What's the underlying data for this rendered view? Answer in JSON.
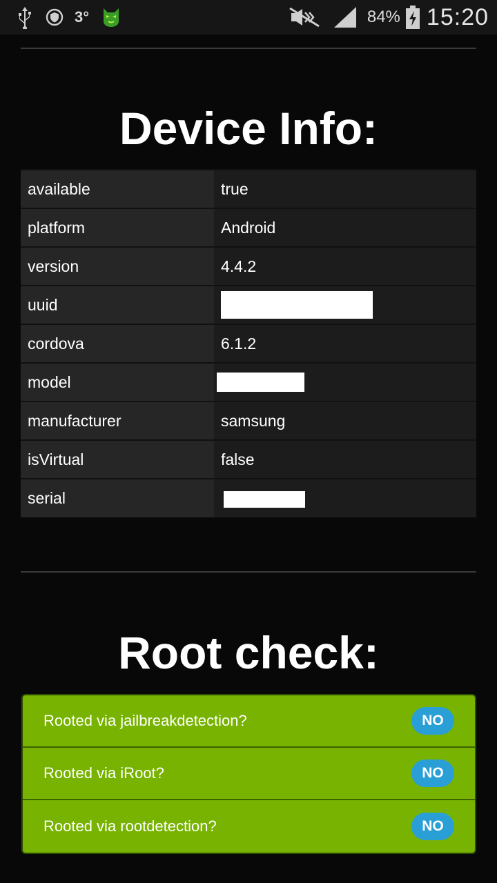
{
  "status_bar": {
    "icons_left": [
      "usb-icon",
      "shield-icon",
      "cat-app-icon"
    ],
    "temperature": "3°",
    "icons_right": [
      "mute-icon",
      "signal-icon",
      "battery-charging-icon"
    ],
    "battery_percent": "84%",
    "time": "15:20"
  },
  "device_info": {
    "title": "Device Info:",
    "rows": [
      {
        "key": "available",
        "value": "true"
      },
      {
        "key": "platform",
        "value": "Android"
      },
      {
        "key": "version",
        "value": "4.4.2"
      },
      {
        "key": "uuid",
        "value": ""
      },
      {
        "key": "cordova",
        "value": "6.1.2"
      },
      {
        "key": "model",
        "value": ""
      },
      {
        "key": "manufacturer",
        "value": "samsung"
      },
      {
        "key": "isVirtual",
        "value": "false"
      },
      {
        "key": "serial",
        "value": ""
      }
    ]
  },
  "root_check": {
    "title": "Root check:",
    "items": [
      {
        "label": "Rooted via jailbreakdetection?",
        "result": "NO"
      },
      {
        "label": "Rooted via iRoot?",
        "result": "NO"
      },
      {
        "label": "Rooted via rootdetection?",
        "result": "NO"
      }
    ]
  },
  "colors": {
    "background": "#080808",
    "status_bar": "#161616",
    "root_panel": "#77b300",
    "badge": "#2a9fd6"
  }
}
